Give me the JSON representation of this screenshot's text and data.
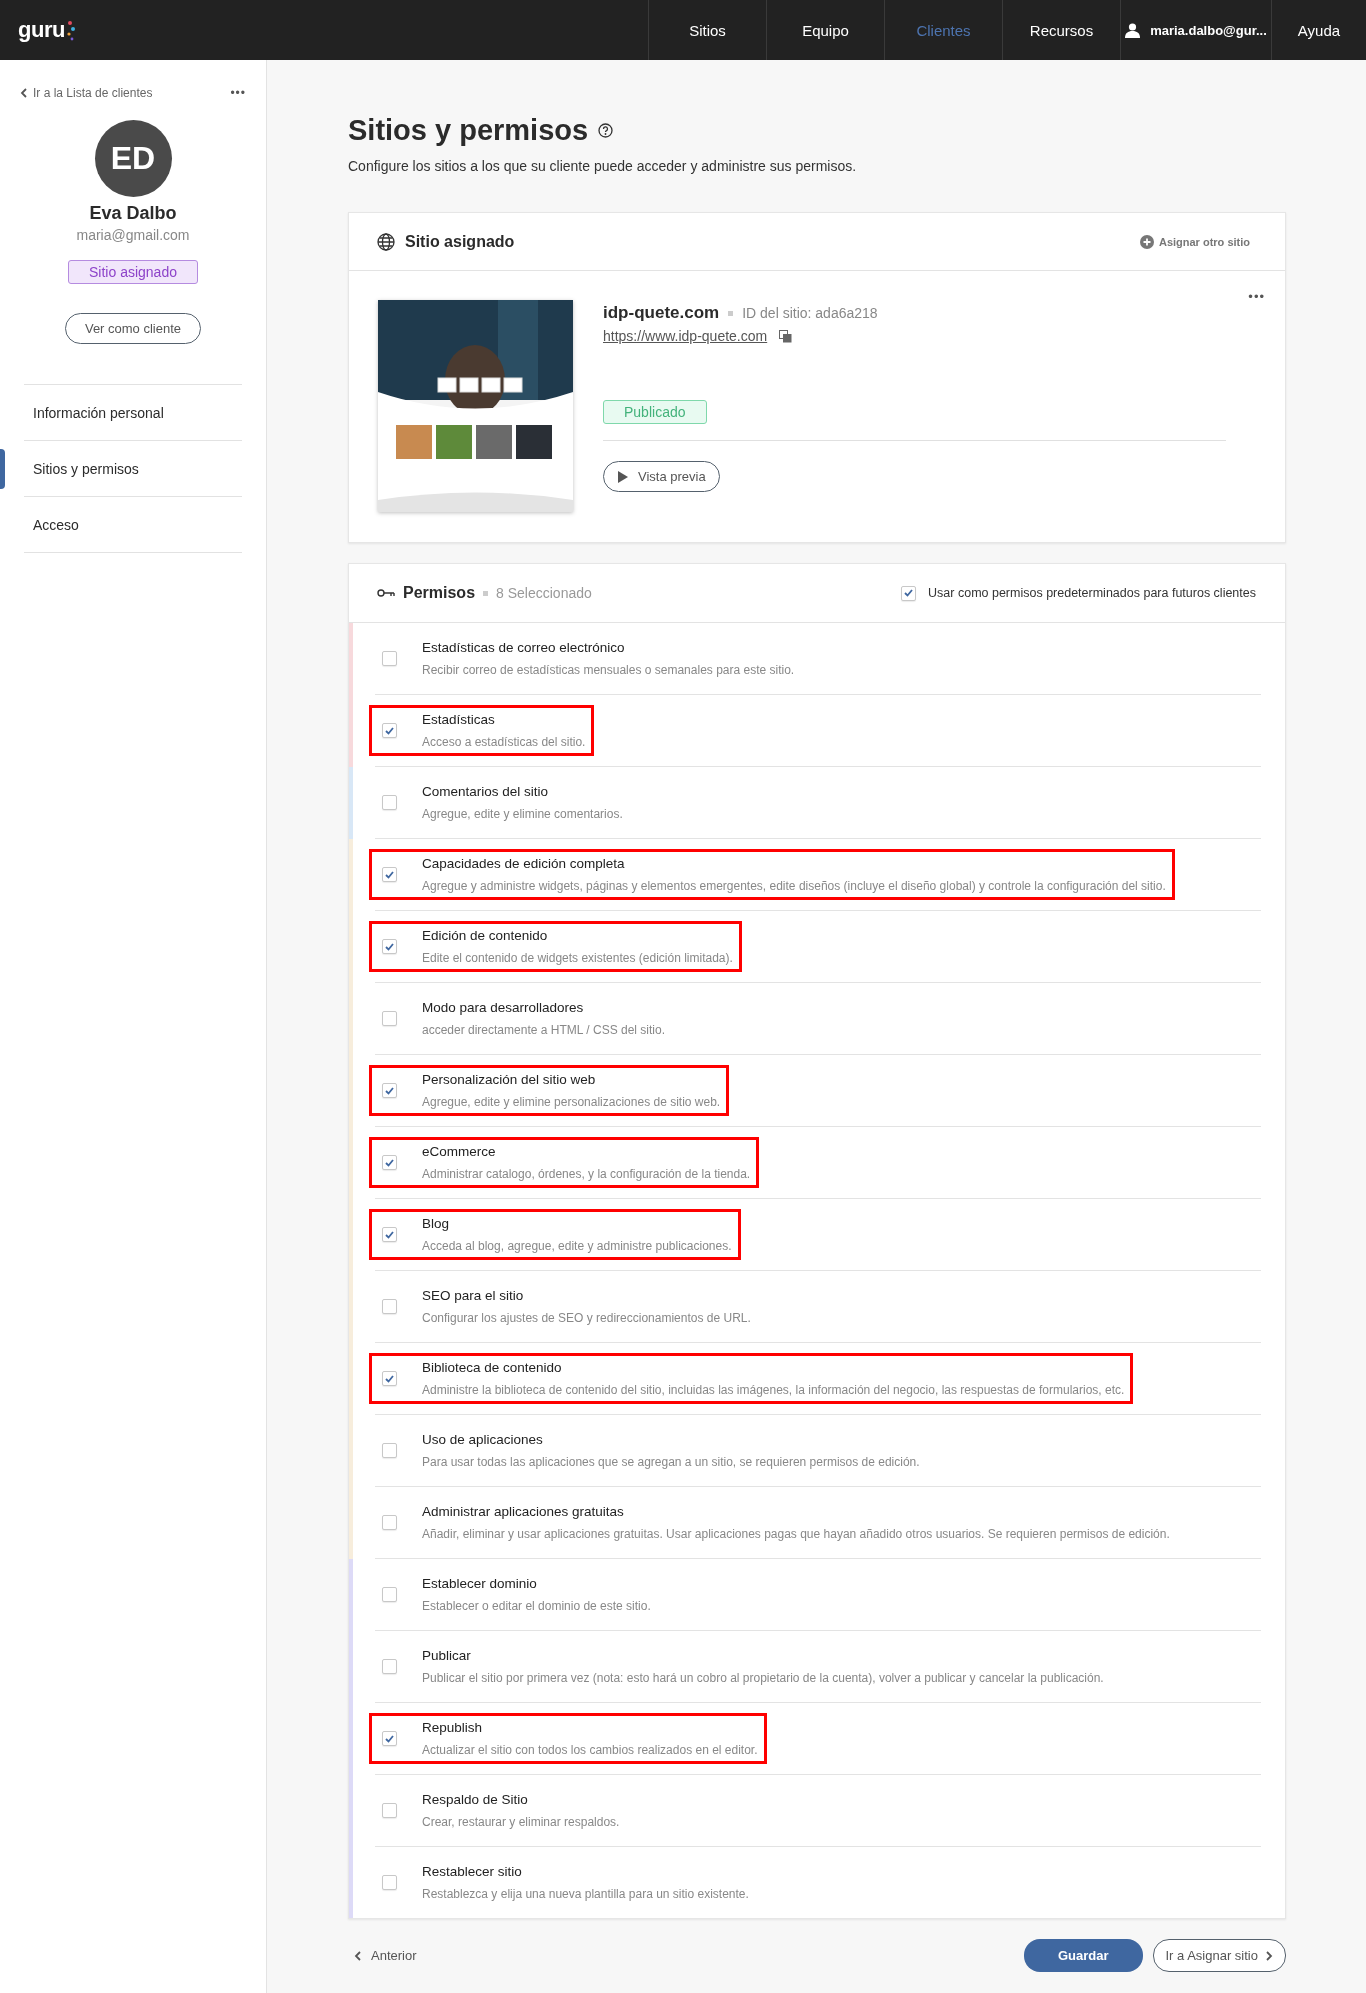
{
  "nav": {
    "logo": "guru",
    "items": [
      {
        "label": "Sitios",
        "selected": false
      },
      {
        "label": "Equipo",
        "selected": false
      },
      {
        "label": "Clientes",
        "selected": true
      },
      {
        "label": "Recursos",
        "selected": false
      }
    ],
    "user": "maria.dalbo@gur...",
    "help": "Ayuda"
  },
  "sidebar": {
    "back": "Ir a la Lista de clientes",
    "more": "•••",
    "initials": "ED",
    "name": "Eva Dalbo",
    "email": "maria@gmail.com",
    "badge": "Sitio asignado",
    "view_button": "Ver como cliente",
    "items": [
      {
        "label": "Información personal",
        "selected": false
      },
      {
        "label": "Sitios y permisos",
        "selected": true
      },
      {
        "label": "Acceso",
        "selected": false
      }
    ]
  },
  "page": {
    "title": "Sitios y permisos",
    "subtitle": "Configure los sitios a los que su cliente puede acceder y administre sus permisos."
  },
  "site_card": {
    "title": "Sitio asignado",
    "assign_other": "Asignar otro sitio",
    "domain": "idp-quete.com",
    "site_id": "ID del sitio: ada6a218",
    "url": "https://www.idp-quete.com",
    "status": "Publicado",
    "more": "•••",
    "preview_button": "Vista previa"
  },
  "permissions": {
    "title": "Permisos",
    "count": "8 Seleccionado",
    "default_label": "Usar como permisos predeterminados para futuros clientes",
    "default_checked": true,
    "items": [
      {
        "title": "Estadísticas de correo electrónico",
        "description": "Recibir correo de estadísticas mensuales o semanales para este sitio.",
        "checked": false,
        "highlighted": false,
        "color": "#f7d9dc"
      },
      {
        "title": "Estadísticas",
        "description": "Acceso a estadísticas del sitio.",
        "checked": true,
        "highlighted": true,
        "color": "#f7d9dc"
      },
      {
        "title": "Comentarios del sitio",
        "description": "Agregue, edite y elimine comentarios.",
        "checked": false,
        "highlighted": false,
        "color": "#d8e7f6"
      },
      {
        "title": "Capacidades de edición completa",
        "description": "Agregue y administre widgets, páginas y elementos emergentes, edite diseños (incluye el diseño global) y controle la configuración del sitio.",
        "checked": true,
        "highlighted": true,
        "color": "#f7eddc"
      },
      {
        "title": "Edición de contenido",
        "description": "Edite el contenido de widgets existentes (edición limitada).",
        "checked": true,
        "highlighted": true,
        "color": "#f7eddc"
      },
      {
        "title": "Modo para desarrolladores",
        "description": "acceder directamente a HTML / CSS del sitio.",
        "checked": false,
        "highlighted": false,
        "color": "#f7eddc"
      },
      {
        "title": "Personalización del sitio web",
        "description": "Agregue, edite y elimine personalizaciones de sitio web.",
        "checked": true,
        "highlighted": true,
        "color": "#f7eddc"
      },
      {
        "title": "eCommerce",
        "description": "Administrar catalogo, órdenes, y la configuración de la tienda.",
        "checked": true,
        "highlighted": true,
        "color": "#f7eddc"
      },
      {
        "title": "Blog",
        "description": "Acceda al blog, agregue, edite y administre publicaciones.",
        "checked": true,
        "highlighted": true,
        "color": "#f7eddc"
      },
      {
        "title": "SEO para el sitio",
        "description": "Configurar los ajustes de SEO y redireccionamientos de URL.",
        "checked": false,
        "highlighted": false,
        "color": "#f7eddc"
      },
      {
        "title": "Biblioteca de contenido",
        "description": "Administre la biblioteca de contenido del sitio, incluidas las imágenes, la información del negocio, las respuestas de formularios, etc.",
        "checked": true,
        "highlighted": true,
        "color": "#f7eddc"
      },
      {
        "title": "Uso de aplicaciones",
        "description": "Para usar todas las aplicaciones que se agregan a un sitio, se requieren permisos de edición.",
        "checked": false,
        "highlighted": false,
        "color": "#f7eddc"
      },
      {
        "title": "Administrar aplicaciones gratuitas",
        "description": "Añadir, eliminar y usar aplicaciones gratuitas. Usar aplicaciones pagas que hayan añadido otros usuarios. Se requieren permisos de edición.",
        "checked": false,
        "highlighted": false,
        "color": "#f7eddc"
      },
      {
        "title": "Establecer dominio",
        "description": "Establecer o editar el dominio de este sitio.",
        "checked": false,
        "highlighted": false,
        "color": "#dddaf7"
      },
      {
        "title": "Publicar",
        "description": "Publicar el sitio por primera vez (nota: esto hará un cobro al propietario de la cuenta), volver a publicar y cancelar la publicación.",
        "checked": false,
        "highlighted": false,
        "color": "#dddaf7"
      },
      {
        "title": "Republish",
        "description": "Actualizar el sitio con todos los cambios realizados en el editor.",
        "checked": true,
        "highlighted": true,
        "color": "#dddaf7"
      },
      {
        "title": "Respaldo de Sitio",
        "description": "Crear, restaurar y eliminar respaldos.",
        "checked": false,
        "highlighted": false,
        "color": "#dddaf7"
      },
      {
        "title": "Restablecer sitio",
        "description": "Restablezca y elija una nueva plantilla para un sitio existente.",
        "checked": false,
        "highlighted": false,
        "color": "#dddaf7"
      }
    ]
  },
  "footer": {
    "previous": "Anterior",
    "save": "Guardar",
    "next": "Ir a Asignar sitio"
  }
}
